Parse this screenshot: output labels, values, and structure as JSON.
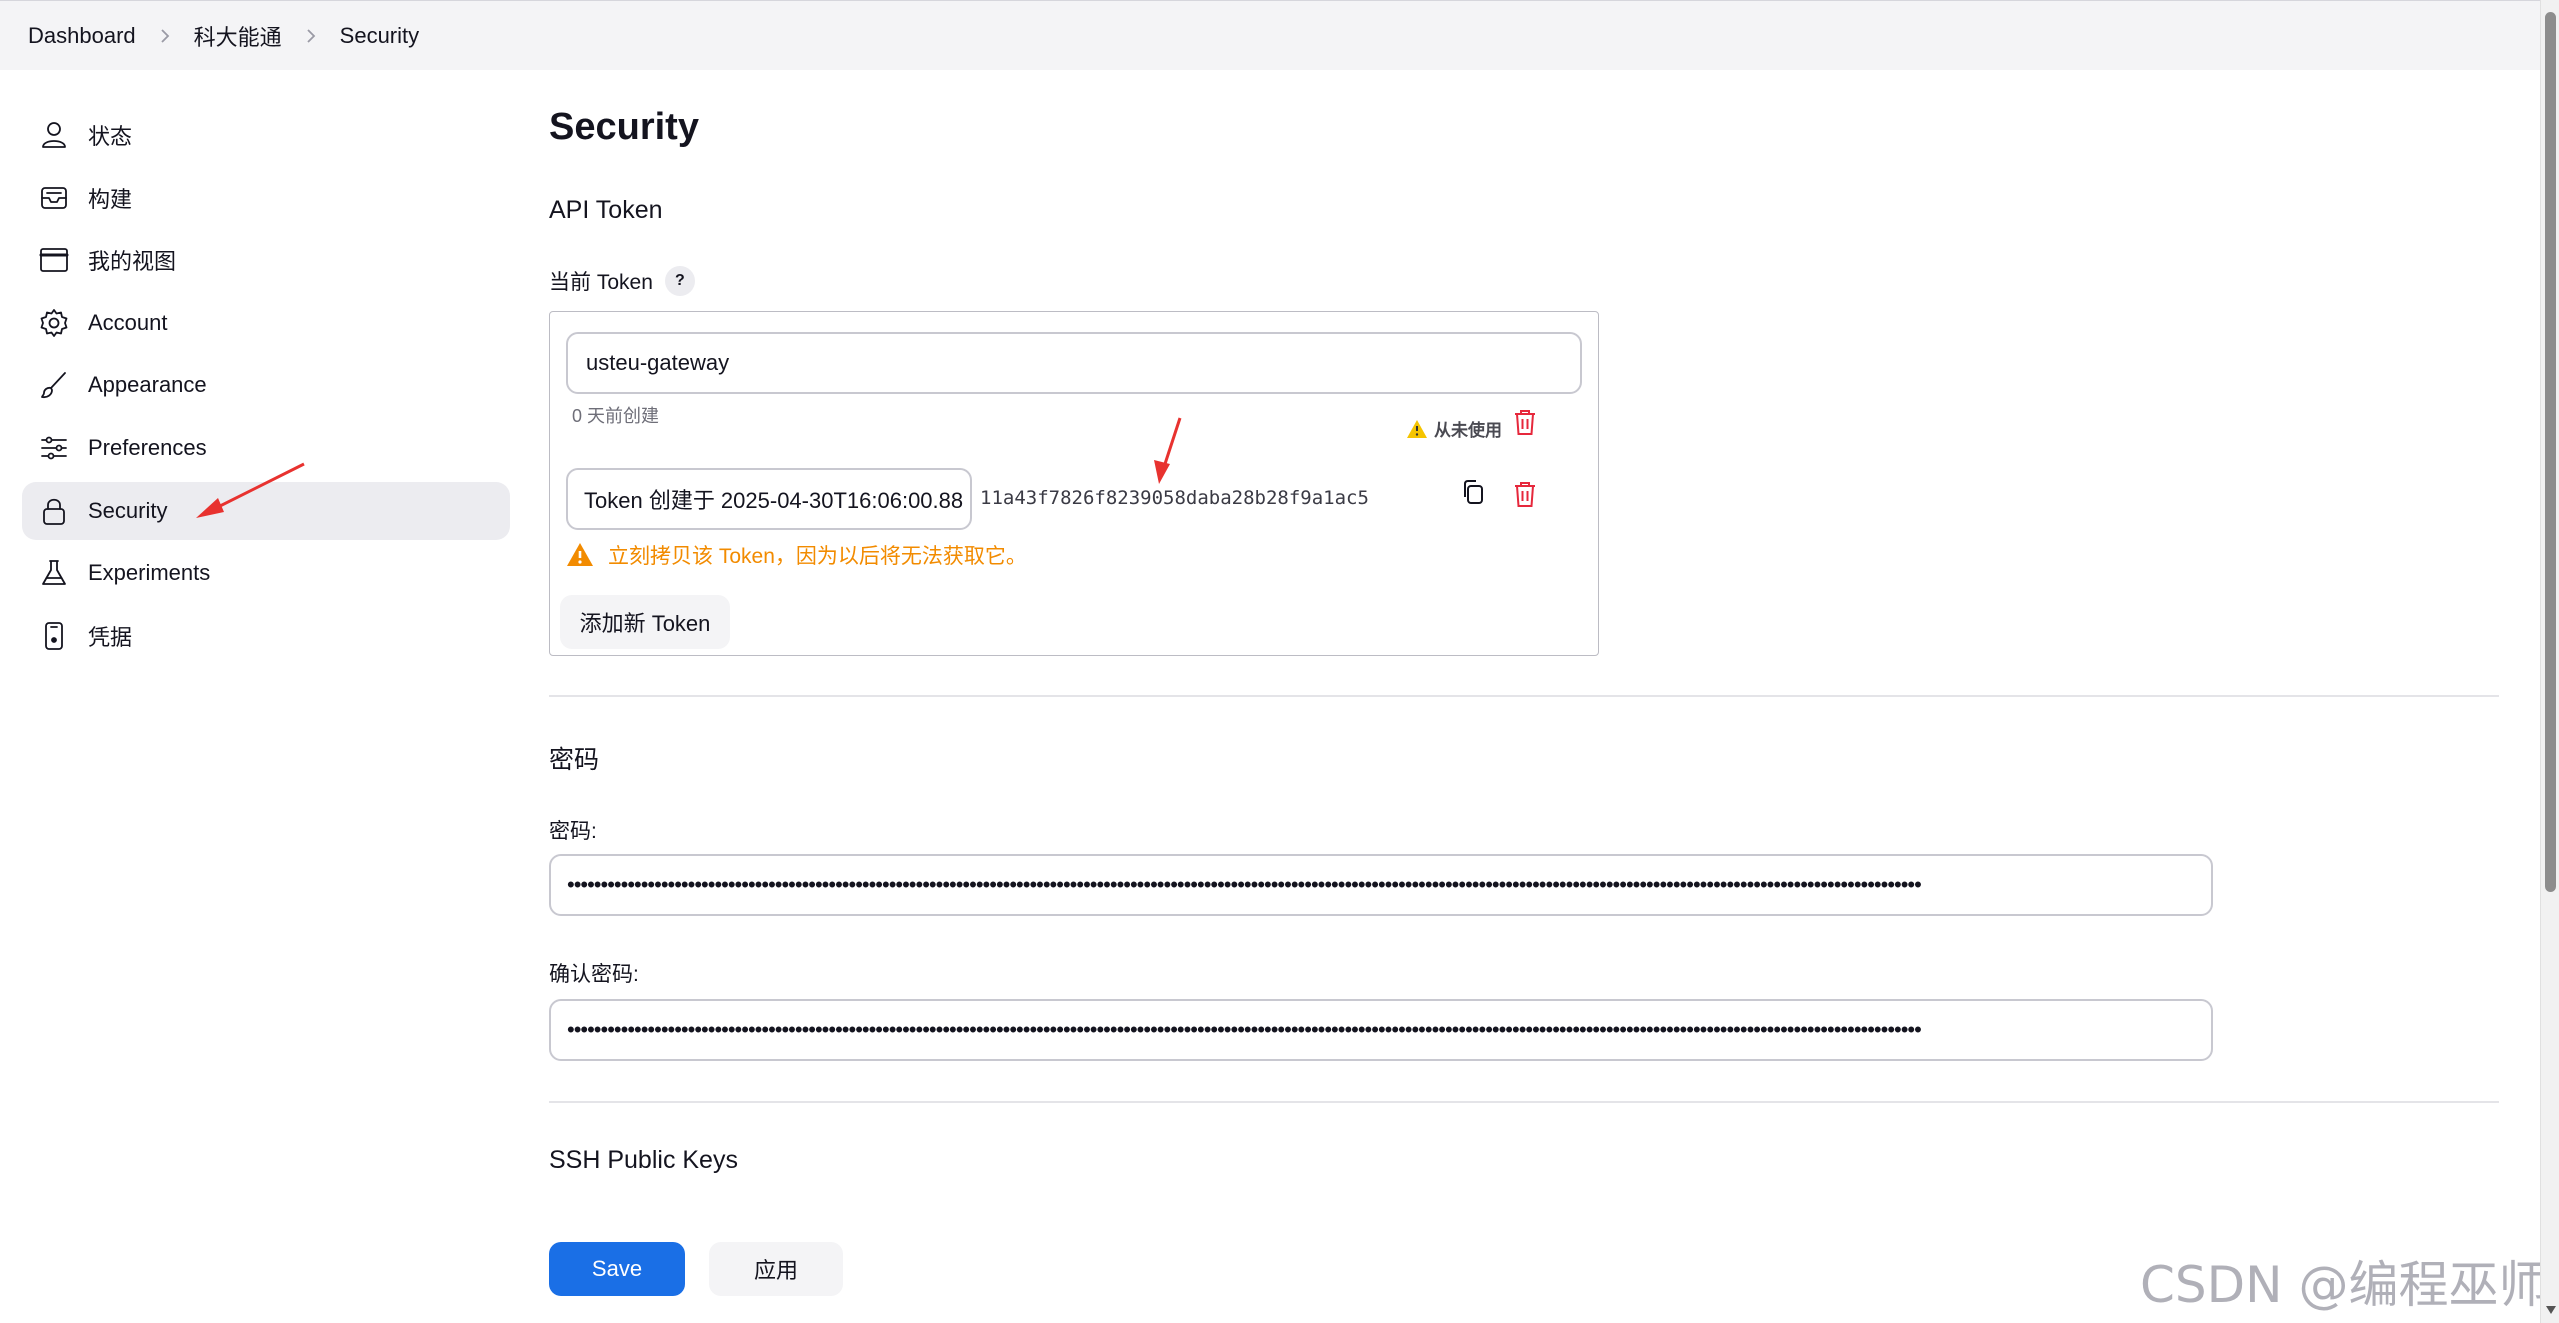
{
  "breadcrumb": {
    "items": [
      "Dashboard",
      "科大能通",
      "Security"
    ]
  },
  "sidebar": {
    "items": [
      {
        "label": "状态",
        "icon": "user-icon"
      },
      {
        "label": "构建",
        "icon": "inbox-icon"
      },
      {
        "label": "我的视图",
        "icon": "window-icon"
      },
      {
        "label": "Account",
        "icon": "gear-icon"
      },
      {
        "label": "Appearance",
        "icon": "brush-icon"
      },
      {
        "label": "Preferences",
        "icon": "sliders-icon"
      },
      {
        "label": "Security",
        "icon": "lock-icon",
        "active": true
      },
      {
        "label": "Experiments",
        "icon": "flask-icon"
      },
      {
        "label": "凭据",
        "icon": "phone-icon"
      }
    ]
  },
  "main": {
    "title": "Security",
    "api_token": {
      "section_title": "API Token",
      "current_label": "当前 Token",
      "help": "?",
      "token_name": "usteu-gateway",
      "created_ago": "0 天前创建",
      "never_used": "从未使用",
      "new_token_name": "Token 创建于 2025-04-30T16:06:00.88",
      "token_value": "11a43f7826f8239058daba28b28f9a1ac5",
      "warning": "立刻拷贝该 Token，因为以后将无法获取它。",
      "add_button": "添加新 Token"
    },
    "password": {
      "section_title": "密码",
      "password_label": "密码:",
      "password_value": "••••••••••••••••••••••••••••••••••••••••••••••••••••••••••••••••••••••••••••••••••••••••••••••••••••••••••••••••••••••••••••••••••••••••••••••••••••••••••••••••••••••••••••••••••••••••••••••••••••••••••",
      "confirm_label": "确认密码:",
      "confirm_value": "••••••••••••••••••••••••••••••••••••••••••••••••••••••••••••••••••••••••••••••••••••••••••••••••••••••••••••••••••••••••••••••••••••••••••••••••••••••••••••••••••••••••••••••••••••••••••••••••••••••••••"
    },
    "ssh": {
      "section_title": "SSH Public Keys"
    }
  },
  "footer": {
    "save": "Save",
    "apply": "应用"
  },
  "watermark": "CSDN @编程巫师",
  "colors": {
    "primary": "#1a6fe6",
    "danger": "#e6283c",
    "warning": "#f28b00",
    "annotation": "#e8322f"
  }
}
